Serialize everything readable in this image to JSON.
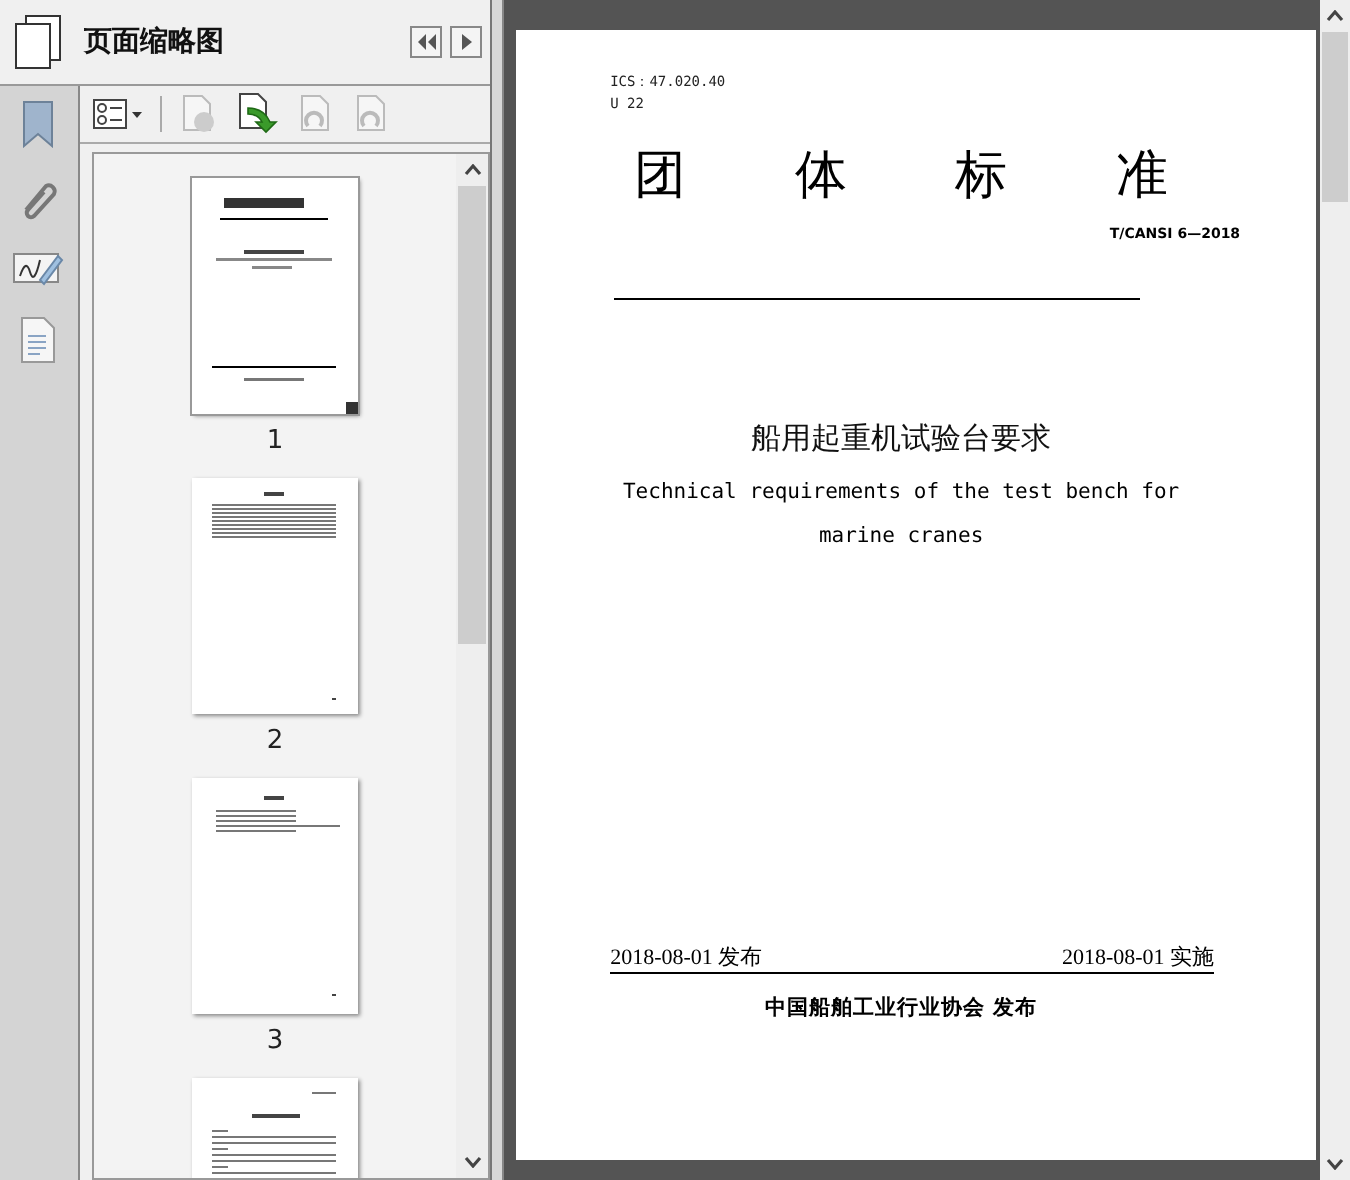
{
  "panel": {
    "title": "页面缩略图"
  },
  "toolbar": [
    {
      "kind": "options",
      "disabled": false
    },
    {
      "kind": "delete",
      "disabled": true
    },
    {
      "kind": "insert",
      "disabled": false
    },
    {
      "kind": "rotate-left",
      "disabled": true
    },
    {
      "kind": "rotate-right",
      "disabled": true
    }
  ],
  "thumbnails": [
    {
      "label": "1",
      "selected": true,
      "kind": "cover"
    },
    {
      "label": "2",
      "selected": false,
      "kind": "contents"
    },
    {
      "label": "3",
      "selected": false,
      "kind": "foreword"
    },
    {
      "selected": false,
      "kind": "body"
    }
  ],
  "document": {
    "ics": "ICS：47.020.40",
    "classification": "U 22",
    "heading": "团 体 标 准",
    "number": "T/CANSI 6—2018",
    "title_zh": "船用起重机试验台要求",
    "title_en": "Technical requirements of the test bench for marine cranes",
    "issue_date": "2018-08-01 发布",
    "effective_date": "2018-08-01 实施",
    "publisher": "中国船舶工业行业协会 发布"
  }
}
